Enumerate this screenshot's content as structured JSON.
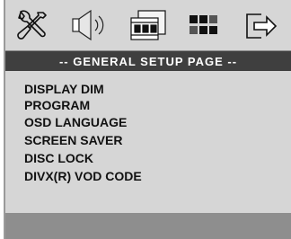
{
  "toolbar": {
    "icons": [
      {
        "name": "general-setup-icon",
        "glyph": "tools (wrench and screwdriver)"
      },
      {
        "name": "audio-setup-icon",
        "glyph": "speaker"
      },
      {
        "name": "video-setup-icon",
        "glyph": "film strip"
      },
      {
        "name": "preference-icon",
        "glyph": "grid of squares"
      },
      {
        "name": "exit-icon",
        "glyph": "exit arrow"
      }
    ]
  },
  "header": {
    "title": "-- GENERAL SETUP PAGE --"
  },
  "menu": {
    "items": [
      {
        "label": "DISPLAY DIM"
      },
      {
        "label": "PROGRAM"
      },
      {
        "label": "OSD LANGUAGE"
      },
      {
        "label": "SCREEN SAVER"
      },
      {
        "label": "DISC LOCK"
      },
      {
        "label": "DIVX(R) VOD CODE"
      }
    ]
  },
  "colors": {
    "panel": "#d6d6d6",
    "title_bar": "#3f3f3f",
    "bottom_bar": "#8e8e8e",
    "text": "#111111"
  }
}
